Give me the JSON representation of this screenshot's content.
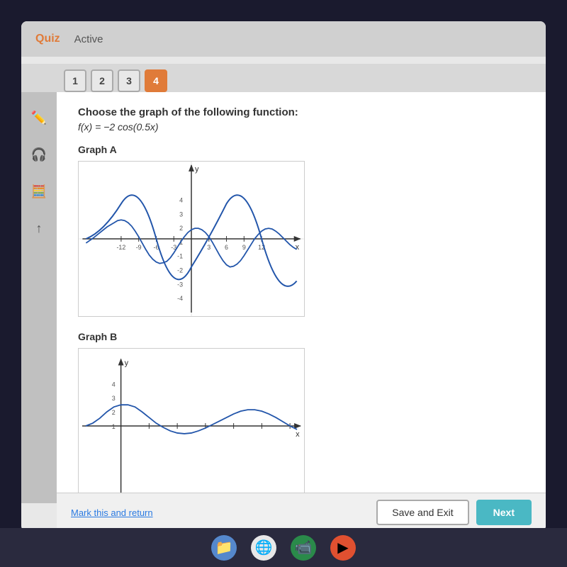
{
  "header": {
    "quiz_label": "Quiz",
    "active_label": "Active"
  },
  "tabs": [
    {
      "number": "1",
      "active": false
    },
    {
      "number": "2",
      "active": false
    },
    {
      "number": "3",
      "active": false
    },
    {
      "number": "4",
      "active": true
    }
  ],
  "question": {
    "instruction": "Choose the graph of the following function:",
    "function": "f(x) = −2 cos(0.5x)"
  },
  "graphs": [
    {
      "label": "Graph A"
    },
    {
      "label": "Graph B"
    }
  ],
  "bottom": {
    "mark_return": "Mark this and return",
    "save_exit": "Save and Exit",
    "next": "Next"
  },
  "sidebar_icons": [
    "pencil",
    "headphones",
    "calculator",
    "arrow-up"
  ],
  "taskbar_icons": [
    "folder",
    "chrome",
    "meet",
    "play"
  ]
}
